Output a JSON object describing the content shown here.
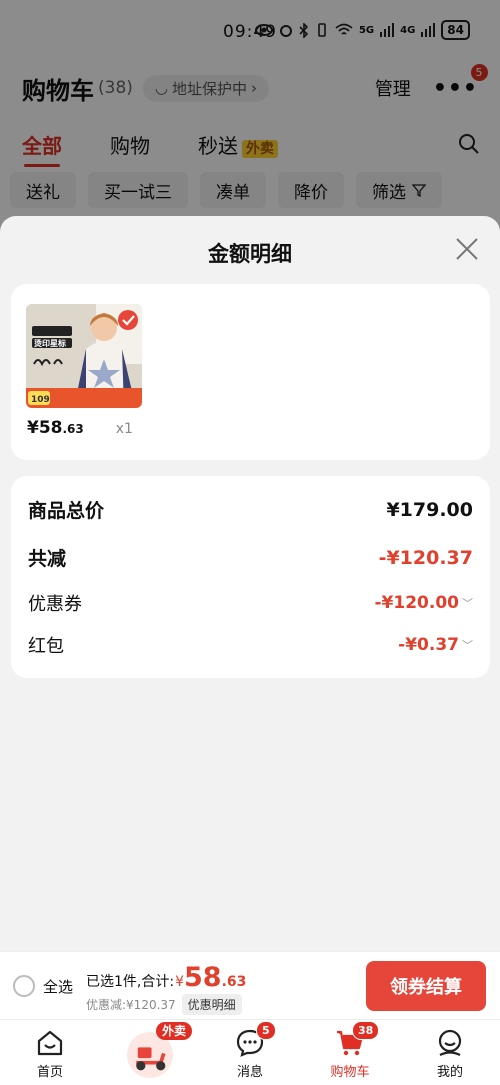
{
  "status": {
    "time": "09:49",
    "battery": "84",
    "net_5g": "5G",
    "net_4g": "4G"
  },
  "header": {
    "title": "购物车",
    "count": "(38)",
    "address": "地址保护中",
    "manage": "管理",
    "more_badge": "5"
  },
  "tabs": {
    "all": "全部",
    "shopping": "购物",
    "seckill": "秒送",
    "waimai_tag": "外卖"
  },
  "filters": [
    "送礼",
    "买一试三",
    "凑单",
    "降价",
    "筛选"
  ],
  "sheet": {
    "title": "金额明细",
    "product": {
      "price_int": "¥58",
      "price_dec": ".63",
      "qty": "x1",
      "thumb_tag": "109",
      "thumb_text": "烫印星标"
    },
    "summary": {
      "total_label": "商品总价",
      "total_value": "¥179.00",
      "reduce_label": "共减",
      "reduce_value": "-¥120.37",
      "coupon_label": "优惠券",
      "coupon_value": "-¥120.00",
      "redpack_label": "红包",
      "redpack_value": "-¥0.37"
    }
  },
  "checkout": {
    "select_all": "全选",
    "selected_text": "已选1件,合计:",
    "currency": "¥",
    "total_int": "58",
    "total_dec": ".63",
    "discount_text": "优惠减:¥120.37",
    "detail_btn": "优惠明细",
    "pay_btn": "领券结算"
  },
  "nav": {
    "home": "首页",
    "waimai_badge": "外卖",
    "messages": "消息",
    "messages_badge": "5",
    "cart": "购物车",
    "cart_badge": "38",
    "me": "我的"
  },
  "colors": {
    "accent": "#e02e24",
    "price": "#e0402c",
    "pay_button": "#e6453a"
  }
}
